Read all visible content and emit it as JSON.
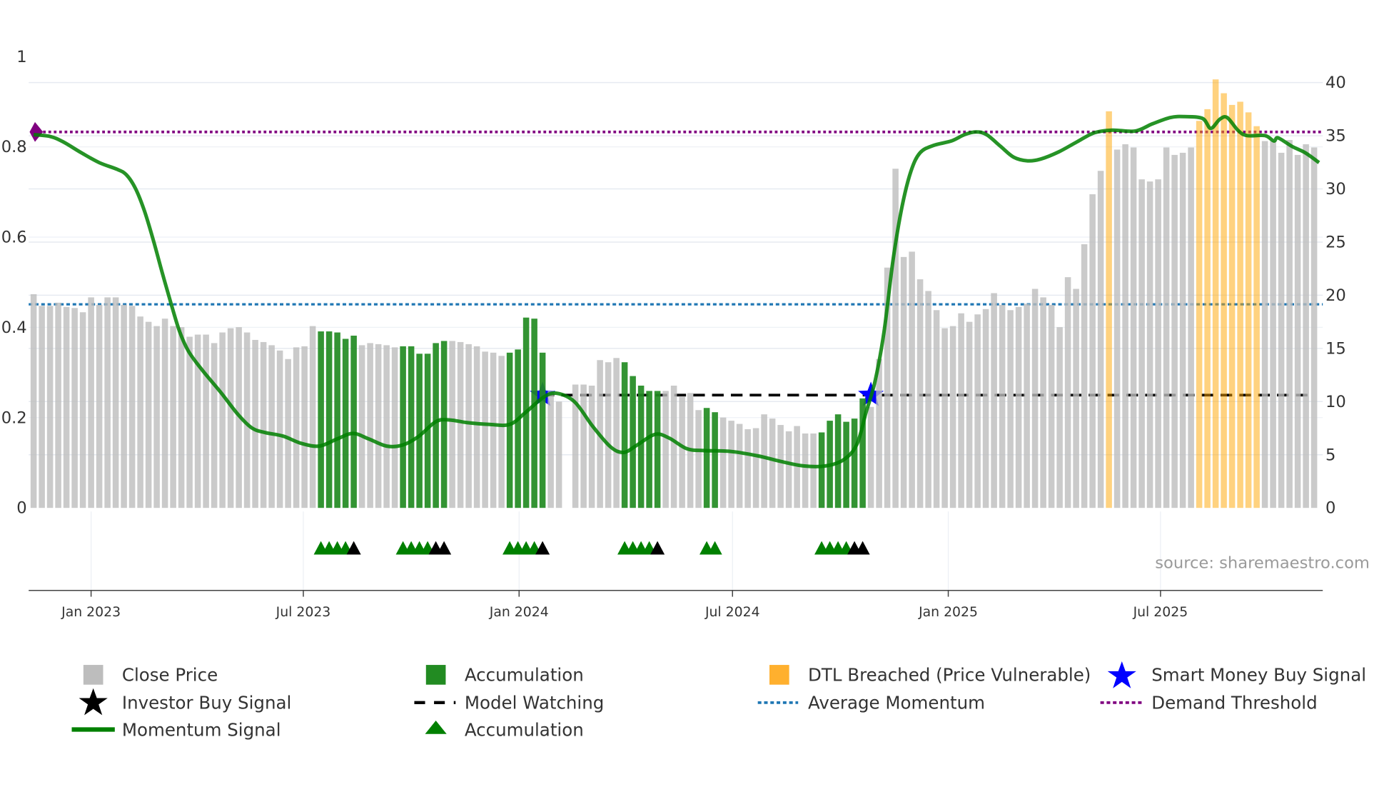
{
  "chart_data": {
    "type": "bar",
    "start_date": "2022-11-13",
    "interval_days": 7,
    "left_axis": {
      "range": [
        0,
        1
      ],
      "ticks": [
        "0",
        "0.2",
        "0.4",
        "0.6",
        "0.8",
        "1"
      ],
      "tick_values": [
        0,
        0.2,
        0.4,
        0.6,
        0.8,
        1
      ]
    },
    "right_axis": {
      "range": [
        0,
        40
      ],
      "ticks": [
        "0",
        "5",
        "10",
        "15",
        "20",
        "25",
        "30",
        "35",
        "40"
      ],
      "tick_values": [
        0,
        5,
        10,
        15,
        20,
        25,
        30,
        35,
        40
      ]
    },
    "x_ticks": [
      {
        "label": "Jan 2023",
        "date": "2023-01-01"
      },
      {
        "label": "Jul 2023",
        "date": "2023-07-01"
      },
      {
        "label": "Jan 2024",
        "date": "2024-01-01"
      },
      {
        "label": "Jul 2024",
        "date": "2024-07-01"
      },
      {
        "label": "Jan 2025",
        "date": "2025-01-01"
      },
      {
        "label": "Jul 2025",
        "date": "2025-07-01"
      }
    ],
    "close_price": [
      20.1,
      19.0,
      19.0,
      19.3,
      18.9,
      18.8,
      18.4,
      19.8,
      19.1,
      19.8,
      19.8,
      19.1,
      19.0,
      18.0,
      17.5,
      17.1,
      17.8,
      17.1,
      17.0,
      16.1,
      16.3,
      16.3,
      15.5,
      16.5,
      16.9,
      17.0,
      16.5,
      15.8,
      15.6,
      15.3,
      14.8,
      14.0,
      15.1,
      15.2,
      17.1,
      16.6,
      16.6,
      16.5,
      15.9,
      16.2,
      15.3,
      15.5,
      15.4,
      15.3,
      15.1,
      15.2,
      15.2,
      14.5,
      14.5,
      15.5,
      15.7,
      15.7,
      15.6,
      15.4,
      15.2,
      14.7,
      14.6,
      14.3,
      14.6,
      14.9,
      17.9,
      17.8,
      14.6,
      11.0,
      10.0,
      null,
      11.6,
      11.6,
      11.5,
      13.9,
      13.7,
      14.1,
      13.7,
      12.4,
      11.5,
      11.0,
      11.0,
      11.0,
      11.5,
      10.5,
      10.8,
      9.2,
      9.4,
      9.0,
      8.5,
      8.2,
      7.9,
      7.4,
      7.5,
      8.8,
      8.4,
      7.8,
      7.2,
      7.7,
      7.0,
      7.0,
      7.1,
      8.2,
      8.8,
      8.1,
      8.4,
      10.3,
      9.5,
      14.0,
      22.6,
      31.9,
      23.6,
      24.1,
      21.5,
      20.4,
      18.6,
      16.9,
      17.1,
      18.3,
      17.5,
      18.2,
      18.7,
      20.2,
      19.1,
      18.6,
      18.9,
      19.2,
      20.6,
      19.8,
      19.1,
      17.0,
      21.7,
      20.6,
      24.8,
      29.5,
      31.7,
      37.3,
      33.7,
      34.2,
      33.9,
      30.9,
      30.7,
      30.9,
      33.9,
      33.2,
      33.4,
      33.9,
      36.4,
      37.5,
      40.3,
      39.0,
      37.9,
      38.2,
      37.2,
      35.9,
      34.5,
      34.5,
      33.4,
      34.6,
      33.2,
      34.2,
      33.9
    ],
    "accumulation_bars": [
      35,
      36,
      37,
      38,
      39,
      45,
      46,
      47,
      48,
      49,
      50,
      58,
      59,
      60,
      61,
      62,
      72,
      73,
      74,
      75,
      76,
      82,
      83,
      96,
      97,
      98,
      99,
      100,
      101
    ],
    "dtl_breached_bars": [
      131,
      142,
      143,
      144,
      145,
      146,
      147,
      148,
      149
    ],
    "accumulation_triangles": [
      35,
      36,
      37,
      38,
      45,
      46,
      47,
      48,
      58,
      59,
      60,
      61,
      72,
      73,
      74,
      75,
      82,
      83,
      96,
      97,
      98,
      99
    ],
    "black_triangles": [
      39,
      49,
      50,
      62,
      76,
      100,
      101
    ],
    "smart_money_buy_signals": [
      {
        "index": 62,
        "value": 0.25
      },
      {
        "index": 102,
        "value": 0.25
      }
    ],
    "model_watching": {
      "from_index": 62,
      "to_index": 156,
      "value": 0.25
    },
    "average_momentum": 0.451,
    "demand_threshold": 0.833,
    "momentum_signal": [
      [
        0,
        0.827
      ],
      [
        2,
        0.823
      ],
      [
        3.6,
        0.811
      ],
      [
        5.8,
        0.787
      ],
      [
        8,
        0.765
      ],
      [
        10.2,
        0.75
      ],
      [
        11.3,
        0.738
      ],
      [
        12.4,
        0.708
      ],
      [
        13.5,
        0.658
      ],
      [
        14.6,
        0.592
      ],
      [
        15.7,
        0.519
      ],
      [
        16.8,
        0.449
      ],
      [
        17.8,
        0.39
      ],
      [
        18.9,
        0.346
      ],
      [
        20.6,
        0.304
      ],
      [
        22.8,
        0.256
      ],
      [
        24.9,
        0.207
      ],
      [
        26.6,
        0.177
      ],
      [
        28.2,
        0.167
      ],
      [
        30.4,
        0.159
      ],
      [
        32.6,
        0.143
      ],
      [
        34.8,
        0.137
      ],
      [
        37,
        0.153
      ],
      [
        38.9,
        0.165
      ],
      [
        40.8,
        0.153
      ],
      [
        43,
        0.137
      ],
      [
        44.9,
        0.139
      ],
      [
        46.8,
        0.157
      ],
      [
        49,
        0.191
      ],
      [
        50.6,
        0.195
      ],
      [
        52.8,
        0.189
      ],
      [
        55.5,
        0.185
      ],
      [
        58,
        0.185
      ],
      [
        59.9,
        0.211
      ],
      [
        62.1,
        0.245
      ],
      [
        63.7,
        0.254
      ],
      [
        65.9,
        0.235
      ],
      [
        68.1,
        0.181
      ],
      [
        70.3,
        0.135
      ],
      [
        71.9,
        0.123
      ],
      [
        73.5,
        0.139
      ],
      [
        75.7,
        0.163
      ],
      [
        77.4,
        0.155
      ],
      [
        79.6,
        0.131
      ],
      [
        81.7,
        0.127
      ],
      [
        85,
        0.125
      ],
      [
        88.3,
        0.115
      ],
      [
        91,
        0.103
      ],
      [
        93.8,
        0.093
      ],
      [
        96.5,
        0.093
      ],
      [
        98.7,
        0.107
      ],
      [
        100.3,
        0.141
      ],
      [
        101.4,
        0.211
      ],
      [
        102.5,
        0.28
      ],
      [
        103.6,
        0.39
      ],
      [
        104.7,
        0.549
      ],
      [
        105.8,
        0.668
      ],
      [
        106.9,
        0.747
      ],
      [
        108,
        0.787
      ],
      [
        109.6,
        0.803
      ],
      [
        111.8,
        0.813
      ],
      [
        113.4,
        0.827
      ],
      [
        114.8,
        0.833
      ],
      [
        116.1,
        0.827
      ],
      [
        117.8,
        0.801
      ],
      [
        119.4,
        0.777
      ],
      [
        121.1,
        0.769
      ],
      [
        122.7,
        0.773
      ],
      [
        124.9,
        0.789
      ],
      [
        127.1,
        0.811
      ],
      [
        129.2,
        0.831
      ],
      [
        131.4,
        0.837
      ],
      [
        134.2,
        0.835
      ],
      [
        136.3,
        0.851
      ],
      [
        138.5,
        0.865
      ],
      [
        140.2,
        0.867
      ],
      [
        142.4,
        0.863
      ],
      [
        143.4,
        0.841
      ],
      [
        144.5,
        0.861
      ],
      [
        145.4,
        0.865
      ],
      [
        146.7,
        0.837
      ],
      [
        147.8,
        0.825
      ],
      [
        150,
        0.825
      ],
      [
        151.1,
        0.813
      ],
      [
        151.6,
        0.82
      ],
      [
        153.3,
        0.801
      ],
      [
        154.9,
        0.787
      ],
      [
        156.6,
        0.765
      ]
    ],
    "source_text": "source: sharemaestro.com",
    "legend_placement": "bottom",
    "legend": [
      {
        "label": "Close Price",
        "symbol": "square",
        "color": "#bdbdbd"
      },
      {
        "label": "Accumulation",
        "symbol": "square",
        "color": "#228b22"
      },
      {
        "label": "DTL Breached (Price Vulnerable)",
        "symbol": "square",
        "color": "#ffb02e"
      },
      {
        "label": "Smart Money Buy Signal",
        "symbol": "star",
        "color": "#0000ff"
      },
      {
        "label": "Investor Buy Signal",
        "symbol": "star",
        "color": "#000000"
      },
      {
        "label": "Model Watching",
        "symbol": "dash",
        "color": "#000000"
      },
      {
        "label": "Average Momentum",
        "symbol": "dot",
        "color": "#1f77b4"
      },
      {
        "label": "Demand Threshold",
        "symbol": "dot",
        "color": "#800080"
      },
      {
        "label": "Momentum Signal",
        "symbol": "line",
        "color": "#008000"
      },
      {
        "label": "Accumulation",
        "symbol": "triangle",
        "color": "#008000"
      }
    ]
  }
}
